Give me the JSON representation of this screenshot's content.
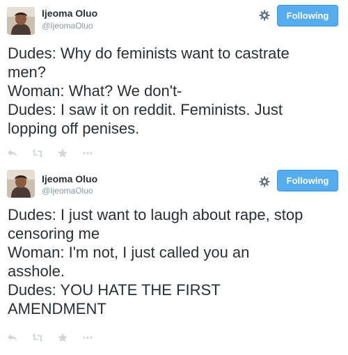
{
  "tweets": [
    {
      "user": {
        "name": "Ijeoma Oluo",
        "handle": "@IjeomaOluo"
      },
      "follow_label": "Following",
      "lines": [
        "Dudes: Why do feminists want to castrate",
        "men?",
        "Woman: What? We don't-",
        "Dudes: I saw it on reddit. Feminists. Just",
        "lopping off penises."
      ],
      "actions": [
        "reply-icon",
        "retweet-icon",
        "favorite-icon",
        "more-icon"
      ]
    },
    {
      "user": {
        "name": "Ijeoma Oluo",
        "handle": "@IjeomaOluo"
      },
      "follow_label": "Following",
      "lines": [
        "Dudes: I just want to laugh about rape, stop",
        "censoring me",
        "Woman: I'm not, I just called you an",
        "asshole.",
        "Dudes: YOU HATE THE FIRST",
        "AMENDMENT"
      ],
      "actions": [
        "reply-icon",
        "retweet-icon",
        "favorite-icon",
        "more-icon"
      ]
    }
  ],
  "colors": {
    "follow_button": "#55acee",
    "name": "#292f33",
    "handle": "#8899a6",
    "action_icons": "#ccd6dd"
  }
}
